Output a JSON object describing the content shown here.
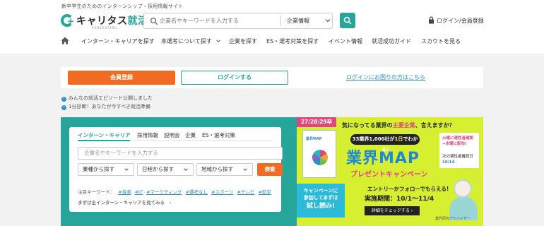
{
  "header": {
    "tagline": "新卒学生のためのインターンシップ・採用情報サイト",
    "logo_text_main": "キャリタス",
    "logo_text_accent": "就活",
    "logo_sub": "CAREERTASU",
    "search_placeholder": "企業名やキーワードを入力する",
    "search_select_value": "企業情報",
    "login_link": "ログイン/会員登録"
  },
  "nav": {
    "items": [
      "インターン・キャリアを探す",
      "本選考について探す",
      "企業を探す",
      "ES・選考対策を探す",
      "イベント情報",
      "就活成功ガイド",
      "スカウトを見る"
    ]
  },
  "login_strip": {
    "signup_label": "会員登録",
    "login_label": "ログインする",
    "trouble_link": "ログインにお困りの方はこちら"
  },
  "notices": [
    "みんなの就活エピソード公開しました",
    "1分診断！あなたが今すべき就活準備"
  ],
  "search_card": {
    "tabs": [
      "インターン・キャリア",
      "採用情報",
      "説明会",
      "企業",
      "ES・選考対策"
    ],
    "input_placeholder": "企業名やキーワードを入力する",
    "selects": [
      "業種から探す",
      "日程から探す",
      "地域から探す"
    ],
    "search_button": "検索",
    "keywords_label": "注目キーワード：",
    "keywords": [
      "#音楽",
      "#IT",
      "#マーケティング",
      "#選考なし",
      "#スポーツ",
      "#テレビ",
      "#航空"
    ],
    "all_link": "まずは全インターン・キャリアを見てみる　›"
  },
  "banner": {
    "tag": "27/28/29卒",
    "card_title": "業界MAP",
    "cta_line1": "キャンペーンに",
    "cta_line2": "参加してまずは",
    "cta_line3": "試し読み!",
    "headline_pre": "気になってる業界の",
    "headline_em": "主要企業",
    "headline_post": "、言えますか？",
    "pill_pre": "33業界1,000社が",
    "pill_em": "1日",
    "pill_post": "でわかる!",
    "big": "業界MAP",
    "sub": "プレゼントキャンペーン",
    "side_line1": "火曜に適性者確認",
    "side_line2": "→木曜に配布!",
    "side_line3": "次の適性者確認日",
    "side_date": "10/14",
    "follow": "エントリーかフォローでもらえる!",
    "period": "実施期間：10/1〜11/4",
    "detail_button": "詳細をチェックする ›",
    "person_label": "業界研究アドバイザー"
  },
  "colors": {
    "brand": "#26a69a",
    "accent_orange": "#f26b22",
    "banner_bg": "#d6ef31",
    "link": "#2a8fc4"
  }
}
